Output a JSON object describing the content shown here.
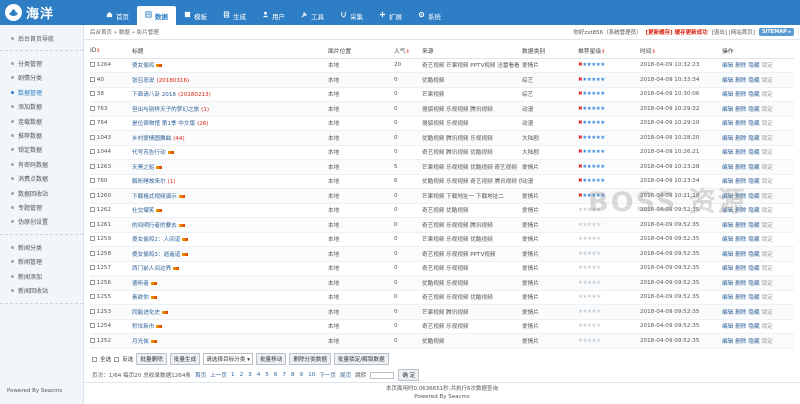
{
  "app": {
    "logo_text": "海洋",
    "powered_by": "Powered By Seacms"
  },
  "nav": [
    {
      "label": "首页",
      "icon": "home-icon"
    },
    {
      "label": "数据",
      "icon": "data-icon",
      "active": true
    },
    {
      "label": "模板",
      "icon": "template-icon"
    },
    {
      "label": "生成",
      "icon": "generate-icon"
    },
    {
      "label": "用户",
      "icon": "user-icon"
    },
    {
      "label": "工具",
      "icon": "tool-icon"
    },
    {
      "label": "采集",
      "icon": "collect-icon"
    },
    {
      "label": "扩展",
      "icon": "extend-icon"
    },
    {
      "label": "系统",
      "icon": "gear-icon"
    }
  ],
  "sidebar": {
    "groups": [
      [
        "后台首页导航"
      ],
      [
        "分类管理",
        "剧情分类",
        "数据管理",
        "添加数据",
        "连载数据",
        "推荐数据",
        "锁定数据",
        "有密码数据",
        "消费点数据",
        "数据回收站",
        "专题管理",
        "伪原创设置"
      ],
      [
        "新闻分类",
        "新闻管理",
        "新闻添加",
        "新闻回收站"
      ]
    ],
    "active": "数据管理"
  },
  "topbar": {
    "breadcrumb": "后台首页 » 数据 » 影片管理",
    "user": "你好zxt856（系统管理员）",
    "update": "[更新缓存] 缓存更新成功",
    "links": "[退出] [网站首页]",
    "sitemap": "SITEMAP ▸"
  },
  "table": {
    "headers": [
      "ID",
      "标题",
      "面片位置",
      "人气",
      "来源",
      "数据类别",
      "推荐星级",
      "时间",
      "操作"
    ],
    "ops": [
      "编辑",
      "删除",
      "隐藏",
      "锁定"
    ],
    "rows": [
      {
        "id": "1264",
        "title": "傻女偷鸡",
        "extra": "",
        "hot": true,
        "pos": "本地",
        "pop": "20",
        "src": "奇艺视频 芒果视频 PPTV视频 迅雷看看",
        "cat": "爱情片",
        "star": 5,
        "time": "2018-04-09 10:32:23"
      },
      {
        "id": "40",
        "title": "张召忠说",
        "extra": "(20180316)",
        "hot": false,
        "pos": "本地",
        "pop": "0",
        "src": "优酷视频",
        "cat": "综艺",
        "star": 5,
        "time": "2018-04-09 10:33:34"
      },
      {
        "id": "38",
        "title": "下面请八卦 2018",
        "extra": "(20180213)",
        "hot": false,
        "pos": "本地",
        "pop": "0",
        "src": "芒果视频",
        "cat": "综艺",
        "star": 5,
        "time": "2018-04-09 10:30:06"
      },
      {
        "id": "763",
        "title": "但出与别样天子的梦幻之旅",
        "extra": "(1)",
        "hot": false,
        "pos": "本地",
        "pop": "0",
        "src": "搜狐视频 乐视视频 腾讯视频",
        "cat": "动漫",
        "star": 5,
        "time": "2018-04-09 10:29:32"
      },
      {
        "id": "764",
        "title": "是位宿物馆 第1季 中文版",
        "extra": "(26)",
        "hot": false,
        "pos": "本地",
        "pop": "0",
        "src": "搜狐视频 乐视视频",
        "cat": "动漫",
        "star": 5,
        "time": "2018-04-09 10:29:10"
      },
      {
        "id": "1043",
        "title": "乡村爱情圆舞曲",
        "extra": "(44)",
        "hot": false,
        "pos": "本地",
        "pop": "0",
        "src": "优酷视频 腾讯视频 乐视视频",
        "cat": "大陆剧",
        "star": 5,
        "time": "2018-04-09 10:28:20"
      },
      {
        "id": "1044",
        "title": "代号苏告行动",
        "extra": "",
        "hot": true,
        "pos": "本地",
        "pop": "0",
        "src": "奇艺视频 腾讯视频 优酷视频",
        "cat": "大陆剧",
        "star": 5,
        "time": "2018-04-09 10:26:21"
      },
      {
        "id": "1263",
        "title": "天黑之船",
        "extra": "",
        "hot": true,
        "pos": "本地",
        "pop": "5",
        "src": "芒果视频 乐视视频 优酷视频 奇艺视频",
        "cat": "爱情片",
        "star": 5,
        "time": "2018-04-09 10:23:28"
      },
      {
        "id": "760",
        "title": "解析睡故来尔",
        "extra": "(1)",
        "hot": false,
        "pos": "本地",
        "pop": "6",
        "src": "优酷视频 乐视视频 奇艺视频 腾讯视频 优酷视频",
        "cat": "动漫",
        "star": 5,
        "time": "2018-04-09 10:23:34"
      },
      {
        "id": "1260",
        "title": "下载格式视频演示",
        "extra": "",
        "hot": true,
        "pos": "本地",
        "pop": "0",
        "src": "芒果视频 下载地址一 下载地址二",
        "cat": "爱情片",
        "star": 5,
        "time": "2018-04-09 10:21:10"
      },
      {
        "id": "1262",
        "title": "社交爆笑",
        "extra": "",
        "hot": true,
        "pos": "本地",
        "pop": "0",
        "src": "奇艺视频 优酷视频",
        "cat": "爱情片",
        "star": 0,
        "time": "2018-04-09 09:52:35"
      },
      {
        "id": "1261",
        "title": "的间明行者的要去",
        "extra": "",
        "hot": true,
        "pos": "本地",
        "pop": "0",
        "src": "奇艺视频 乐视视频 腾讯视频",
        "cat": "爱情片",
        "star": 0,
        "time": "2018-04-09 09:52:35"
      },
      {
        "id": "1259",
        "title": "傻女偷鸡2：人间道",
        "extra": "",
        "hot": true,
        "pos": "本地",
        "pop": "0",
        "src": "芒果视频 乐视视频 优酷视频",
        "cat": "爱情片",
        "star": 0,
        "time": "2018-04-09 09:52:35"
      },
      {
        "id": "1258",
        "title": "傻女偷鸡3：逍遥道",
        "extra": "",
        "hot": true,
        "pos": "本地",
        "pop": "0",
        "src": "奇艺视频 乐视视频 PPTV视频",
        "cat": "爱情片",
        "star": 0,
        "time": "2018-04-09 09:52:35"
      },
      {
        "id": "1257",
        "title": "西门前人间边界",
        "extra": "",
        "hot": true,
        "pos": "本地",
        "pop": "0",
        "src": "奇艺视频 乐视视频",
        "cat": "爱情片",
        "star": 0,
        "time": "2018-04-09 09:52:35"
      },
      {
        "id": "1256",
        "title": "德听者",
        "extra": "",
        "hot": true,
        "pos": "本地",
        "pop": "0",
        "src": "优酷视频 乐视视频",
        "cat": "爱情片",
        "star": 0,
        "time": "2018-04-09 09:52:35"
      },
      {
        "id": "1255",
        "title": "素欲你",
        "extra": "",
        "hot": true,
        "pos": "本地",
        "pop": "0",
        "src": "奇艺视频 乐视视频 优酷视频",
        "cat": "爱情片",
        "star": 0,
        "time": "2018-04-09 09:52:35"
      },
      {
        "id": "1253",
        "title": "同能进化史",
        "extra": "",
        "hot": true,
        "pos": "本地",
        "pop": "0",
        "src": "芒果视频 腾讯视频",
        "cat": "爱情片",
        "star": 0,
        "time": "2018-04-09 09:52:35"
      },
      {
        "id": "1254",
        "title": "积坟新市",
        "extra": "",
        "hot": true,
        "pos": "本地",
        "pop": "0",
        "src": "奇艺视频 乐视视频",
        "cat": "爱情片",
        "star": 0,
        "time": "2018-04-09 09:52:35"
      },
      {
        "id": "1252",
        "title": "月光侠",
        "extra": "",
        "hot": true,
        "pos": "本地",
        "pop": "0",
        "src": "优酷视频",
        "cat": "爱情片",
        "star": 0,
        "time": "2018-04-09 09:52:35"
      }
    ]
  },
  "actions": {
    "select_all": "全选",
    "invert": "反选",
    "buttons": [
      "批量删除",
      "批量生成",
      "批量移动",
      "删除分类数据",
      "批量锁定/解锁数据"
    ],
    "select_placeholder": "请选择目标分类"
  },
  "pager": {
    "info": "页次：1/64 每页20 总收录数据1264条",
    "first": "首页",
    "prev": "上一页",
    "pages": [
      "1",
      "2",
      "3",
      "4",
      "5",
      "6",
      "7",
      "8",
      "9",
      "10"
    ],
    "next": "下一页",
    "last": "尾页",
    "jump_label": "跳转",
    "go": "确 定"
  },
  "footer": {
    "line1": "本页面用时0.0636651秒,共执行6次数据查询",
    "line2": "Powered By Seacms"
  },
  "watermark": "BOSS 资源"
}
